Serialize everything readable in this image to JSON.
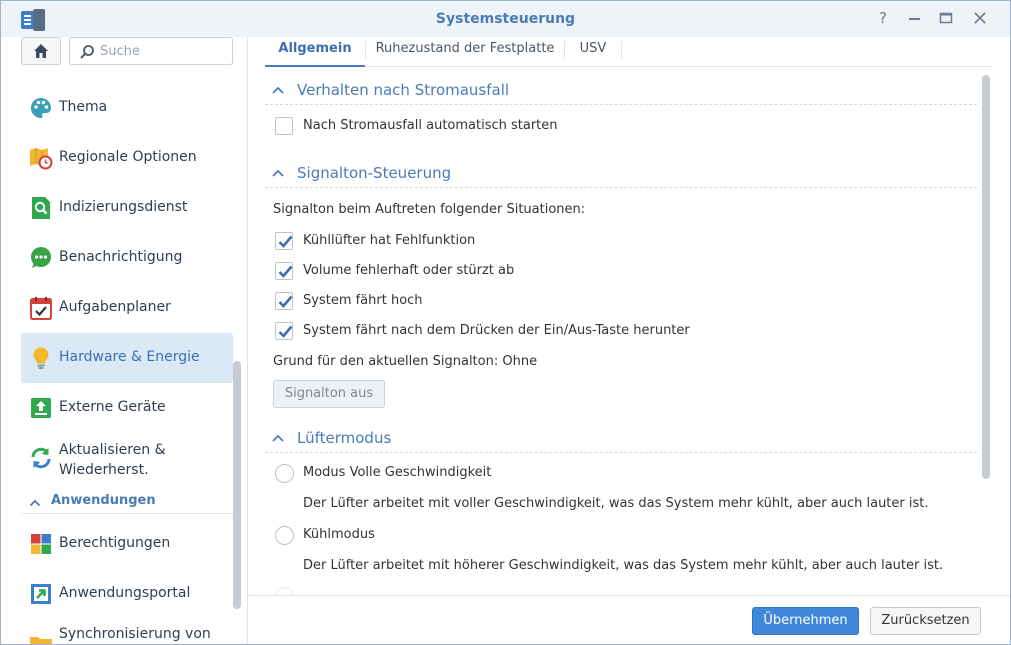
{
  "window": {
    "title": "Systemsteuerung",
    "controls": [
      "help-icon",
      "minimize-icon",
      "maximize-icon",
      "close-icon"
    ]
  },
  "sidebar": {
    "search_placeholder": "Suche",
    "items": [
      {
        "label": "Thema",
        "icon": "palette-icon"
      },
      {
        "label": "Regionale Optionen",
        "icon": "map-clock-icon"
      },
      {
        "label": "Indizierungsdienst",
        "icon": "magnifier-document-icon"
      },
      {
        "label": "Benachrichtigung",
        "icon": "chat-bubble-icon"
      },
      {
        "label": "Aufgabenplaner",
        "icon": "calendar-check-icon"
      },
      {
        "label": "Hardware & Energie",
        "icon": "light-bulb-icon",
        "active": true
      },
      {
        "label": "Externe Geräte",
        "icon": "upload-device-icon"
      },
      {
        "label": "Aktualisieren & Wiederherst.",
        "icon": "refresh-arrows-icon"
      }
    ],
    "section_label": "Anwendungen",
    "app_items": [
      {
        "label": "Berechtigungen",
        "icon": "colored-blocks-icon"
      },
      {
        "label": "Anwendungsportal",
        "icon": "portal-arrow-icon"
      },
      {
        "label": "Synchronisierung von",
        "icon": "sync-folder-icon"
      }
    ]
  },
  "tabs": [
    {
      "label": "Allgemein",
      "active": true
    },
    {
      "label": "Ruhezustand der Festplatte",
      "active": false
    },
    {
      "label": "USV",
      "active": false
    }
  ],
  "power_failure": {
    "title": "Verhalten nach Stromausfall",
    "auto_start_label": "Nach Stromausfall automatisch starten",
    "auto_start_checked": false
  },
  "beep": {
    "title": "Signalton-Steuerung",
    "intro": "Signalton beim Auftreten folgender Situationen:",
    "options": [
      {
        "label": "Kühllüfter hat Fehlfunktion",
        "checked": true
      },
      {
        "label": "Volume fehlerhaft oder stürzt ab",
        "checked": true
      },
      {
        "label": "System fährt hoch",
        "checked": true
      },
      {
        "label": "System fährt nach dem Drücken der Ein/Aus-Taste herunter",
        "checked": true
      }
    ],
    "reason": "Grund für den aktuellen Signalton: Ohne",
    "off_button": "Signalton aus"
  },
  "fan": {
    "title": "Lüftermodus",
    "modes": [
      {
        "label": "Modus Volle Geschwindigkeit",
        "desc": "Der Lüfter arbeitet mit voller Geschwindigkeit, was das System mehr kühlt, aber auch lauter ist."
      },
      {
        "label": "Kühlmodus",
        "desc": "Der Lüfter arbeitet mit höherer Geschwindigkeit, was das System mehr kühlt, aber auch lauter ist."
      }
    ]
  },
  "footer": {
    "apply": "Übernehmen",
    "reset": "Zurücksetzen"
  },
  "colors": {
    "accent": "#4a7bb7",
    "primary_button": "#3e87d9",
    "active_nav_bg": "#dbe9f7"
  }
}
